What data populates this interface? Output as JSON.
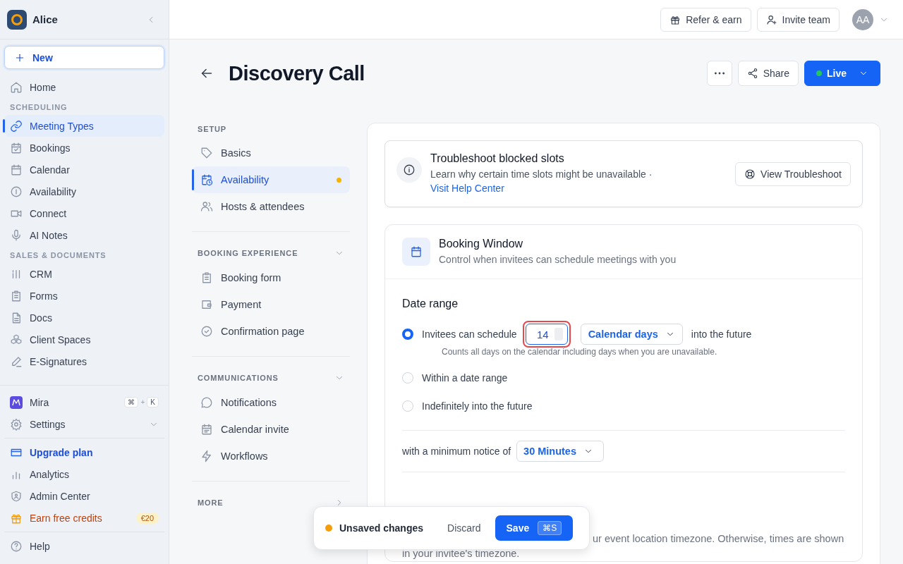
{
  "sidebar": {
    "workspace": "Alice",
    "new_button": "New",
    "nav": [
      {
        "kind": "item",
        "label": "Home",
        "selected": false
      },
      {
        "kind": "section",
        "label": "SCHEDULING"
      },
      {
        "kind": "item",
        "label": "Meeting Types",
        "selected": true
      },
      {
        "kind": "item",
        "label": "Bookings",
        "selected": false
      },
      {
        "kind": "item",
        "label": "Calendar",
        "selected": false
      },
      {
        "kind": "item",
        "label": "Availability",
        "selected": false
      },
      {
        "kind": "item",
        "label": "Connect",
        "selected": false
      },
      {
        "kind": "item",
        "label": "AI Notes",
        "selected": false
      },
      {
        "kind": "section",
        "label": "SALES & DOCUMENTS"
      },
      {
        "kind": "item",
        "label": "CRM",
        "selected": false
      },
      {
        "kind": "item",
        "label": "Forms",
        "selected": false
      },
      {
        "kind": "item",
        "label": "Docs",
        "selected": false
      },
      {
        "kind": "item",
        "label": "Client Spaces",
        "selected": false
      },
      {
        "kind": "item",
        "label": "E-Signatures",
        "selected": false
      }
    ],
    "assistant": {
      "label": "Mira",
      "keys": [
        "⌘",
        "K"
      ],
      "joiner": "+"
    },
    "settings": {
      "label": "Settings",
      "expanded": false
    },
    "footer": [
      {
        "kind": "upgrade",
        "label": "Upgrade plan"
      },
      {
        "kind": "plain",
        "label": "Analytics"
      },
      {
        "kind": "plain",
        "label": "Admin Center"
      },
      {
        "kind": "credits",
        "label": "Earn free credits",
        "badge": "€20"
      }
    ],
    "help": "Help"
  },
  "topbar": {
    "refer": "Refer & earn",
    "invite": "Invite team",
    "avatar": "AA"
  },
  "header": {
    "title": "Discovery Call",
    "share": "Share",
    "live": "Live"
  },
  "subnav": [
    {
      "title": "SETUP",
      "items": [
        {
          "label": "Basics",
          "selected": false,
          "modified": false
        },
        {
          "label": "Availability",
          "selected": true,
          "modified": true
        },
        {
          "label": "Hosts & attendees",
          "selected": false,
          "modified": false
        }
      ]
    },
    {
      "title": "BOOKING EXPERIENCE",
      "expanded": true,
      "items": [
        {
          "label": "Booking form",
          "selected": false,
          "modified": false
        },
        {
          "label": "Payment",
          "selected": false,
          "modified": false
        },
        {
          "label": "Confirmation page",
          "selected": false,
          "modified": false
        }
      ]
    },
    {
      "title": "COMMUNICATIONS",
      "expanded": true,
      "items": [
        {
          "label": "Notifications",
          "selected": false,
          "modified": false
        },
        {
          "label": "Calendar invite",
          "selected": false,
          "modified": false
        },
        {
          "label": "Workflows",
          "selected": false,
          "modified": false
        }
      ]
    },
    {
      "title": "MORE",
      "expanded": false
    }
  ],
  "troubleshoot": {
    "title": "Troubleshoot blocked slots",
    "text": "Learn why certain time slots might be unavailable ·",
    "link": "Visit Help Center",
    "button": "View Troubleshoot"
  },
  "booking_window": {
    "title": "Booking Window",
    "subtitle": "Control when invitees can schedule meetings with you",
    "section": "Date range",
    "options": [
      {
        "kind": "schedule",
        "selected": true,
        "label": "Invitees can schedule",
        "value": "14",
        "unit": "Calendar days",
        "suffix": "into the future",
        "hint": "Counts all days on the calendar including days when you are unavailable."
      },
      {
        "kind": "plain",
        "selected": false,
        "label": "Within a date range"
      },
      {
        "kind": "plain",
        "selected": false,
        "label": "Indefinitely into the future"
      }
    ],
    "notice_label": "with a minimum notice of",
    "notice_value": "30 Minutes",
    "timezone_text": [
      "ur event location timezone. Otherwise, times are shown",
      "in your invitee's timezone."
    ]
  },
  "toast": {
    "label": "Unsaved changes",
    "discard": "Discard",
    "save": "Save",
    "shortcut": "⌘S"
  }
}
